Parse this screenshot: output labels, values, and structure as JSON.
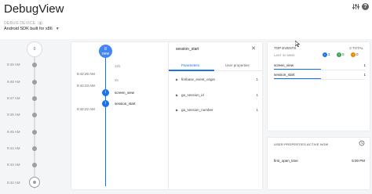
{
  "app": {
    "title": "DebugView"
  },
  "header": {
    "filter_icon": "tune-icon",
    "help_icon": "help-icon"
  },
  "device": {
    "label": "DEBUG DEVICE",
    "count": "1",
    "selected": "Android SDK built for x86",
    "caret": "▼"
  },
  "minutes": {
    "top_count": "0",
    "ticks": [
      "9:49 AM",
      "9:48 AM",
      "9:47 AM",
      "9:46 AM",
      "9:45 AM",
      "9:44 AM",
      "9:43 AM",
      "9:42 AM"
    ]
  },
  "seconds": {
    "bubble_count": "8",
    "bubble_label": "new",
    "rows": [
      {
        "time": "",
        "gap": "12s"
      },
      {
        "time": "9:42:26 AM",
        "gap": ""
      },
      {
        "time": "9:42:23 AM",
        "gap": "2s"
      },
      {
        "time": "",
        "event": "screen_view"
      },
      {
        "time": "9:42:22 AM",
        "event": "session_start"
      }
    ]
  },
  "detail": {
    "event_name": "session_start",
    "close": "✕",
    "tabs": [
      "Parameters",
      "User properties"
    ],
    "active_tab": 0,
    "params": [
      {
        "name": "firebase_event_origin",
        "count": "1"
      },
      {
        "name": "ga_session_id",
        "count": "1"
      },
      {
        "name": "ga_session_number",
        "count": "1"
      }
    ]
  },
  "top_events": {
    "title": "TOP EVENTS",
    "total": "2 TOTAL",
    "subtitle": "LAST 30 MINS",
    "stats": [
      {
        "icon": "info-icon",
        "value": "2",
        "color": "#1a73e8"
      },
      {
        "icon": "warning-icon",
        "value": "0",
        "color": "#34a853"
      },
      {
        "icon": "error-icon",
        "value": "0",
        "color": "#ea8600"
      }
    ],
    "events": [
      {
        "name": "screen_view",
        "count": "1",
        "share": 1.0
      },
      {
        "name": "session_start",
        "count": "1",
        "share": 1.0
      }
    ]
  },
  "user_properties": {
    "title": "USER PROPERTIES ACTIVE NOW",
    "history_icon": "history-icon",
    "items": [
      {
        "name": "first_open_time",
        "value": "5:00 PM"
      }
    ]
  },
  "colors": {
    "accent": "#1a73e8",
    "timeline": "#dadce0"
  }
}
